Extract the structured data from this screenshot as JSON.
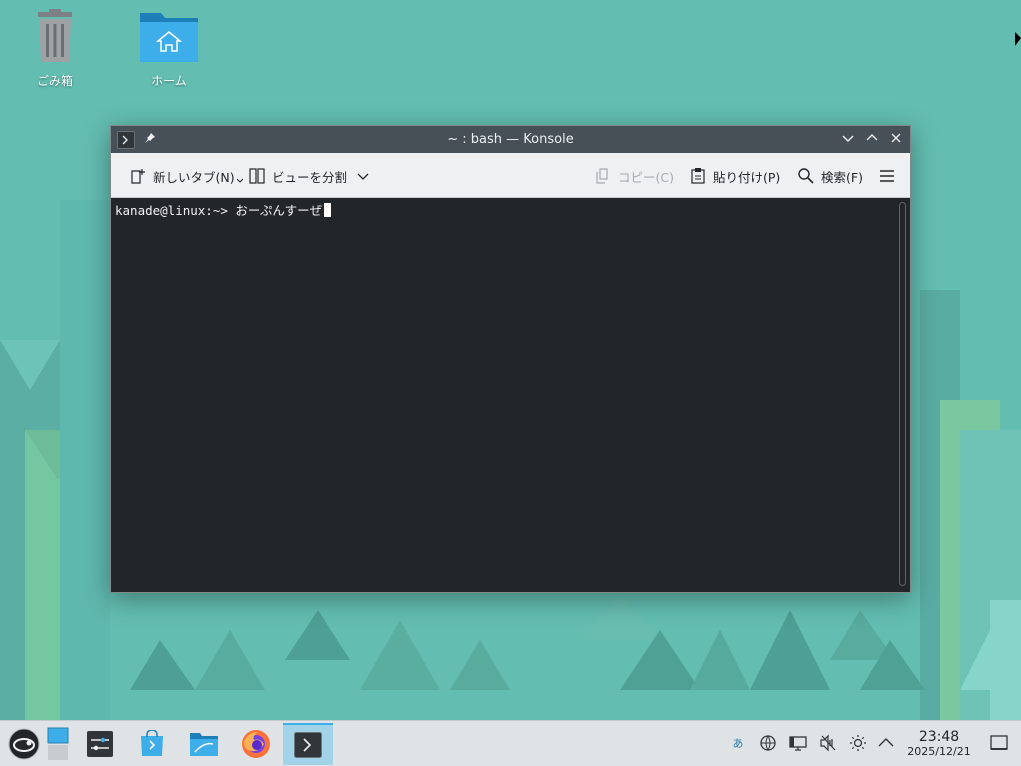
{
  "desktop": {
    "icons": [
      {
        "label": "ごみ箱",
        "icon": "trash-icon"
      },
      {
        "label": "ホーム",
        "icon": "home-folder-icon"
      }
    ]
  },
  "window": {
    "title": "~ : bash — Konsole",
    "toolbar": {
      "new_tab": "新しいタブ(N)",
      "split_view": "ビューを分割",
      "copy": "コピー(C)",
      "paste": "貼り付け(P)",
      "find": "検索(F)"
    },
    "terminal": {
      "prompt": "kanade@linux:~>",
      "input": "おーぷんすーぜ"
    }
  },
  "taskbar": {
    "apps": [
      {
        "name": "opensuse-launcher-icon"
      },
      {
        "name": "pager-icon"
      },
      {
        "name": "system-settings-icon"
      },
      {
        "name": "discover-icon"
      },
      {
        "name": "dolphin-icon"
      },
      {
        "name": "firefox-icon"
      },
      {
        "name": "konsole-icon",
        "active": true
      }
    ],
    "tray": {
      "input_method": "あ",
      "icons": [
        "network-icon",
        "display-icon",
        "volume-muted-icon",
        "brightness-icon",
        "chevron-up-icon"
      ]
    },
    "clock": {
      "time": "23:48",
      "date": "2025/12/21"
    }
  },
  "colors": {
    "wallpaper": "#62bcb0",
    "titlebar": "#475057",
    "terminal_bg": "#232629",
    "accent": "#3daee9"
  }
}
